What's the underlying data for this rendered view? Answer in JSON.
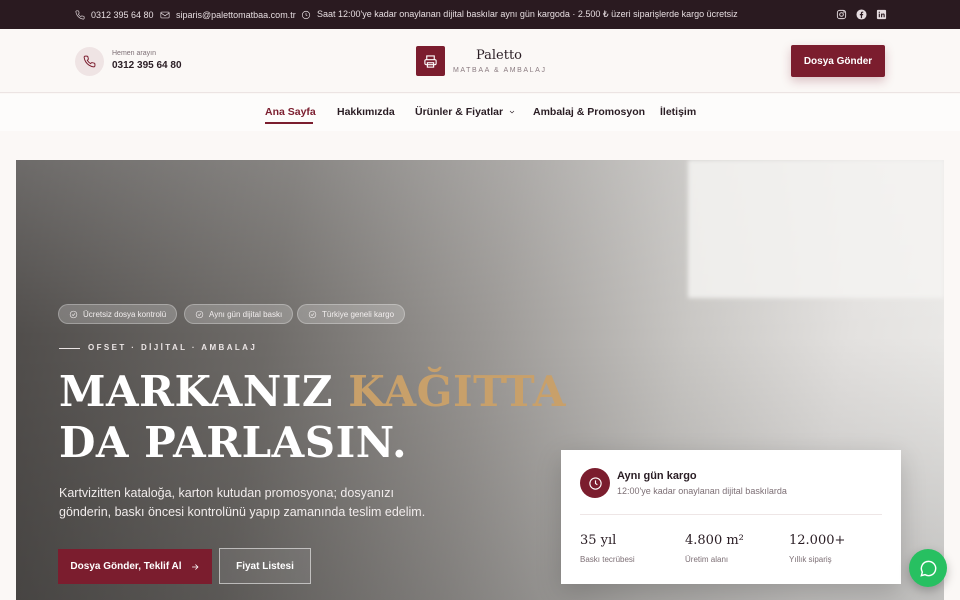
{
  "topbar": {
    "phone": "0312 395 64 80",
    "email": "siparis@palettomatbaa.com.tr",
    "notice": "Saat 12:00'ye kadar onaylanan dijital baskılar aynı gün kargoda · 2.500 ₺ üzeri siparişlerde kargo ücretsiz",
    "social_icons": [
      "instagram-icon",
      "facebook-icon",
      "linkedin-icon"
    ]
  },
  "header": {
    "call_label": "Hemen arayın",
    "call_number": "0312 395 64 80",
    "brand": "Paletto",
    "tagline": "MATBAA & AMBALAJ",
    "cta": "Dosya Gönder"
  },
  "nav": {
    "items": [
      {
        "label": "Ana Sayfa",
        "active": true
      },
      {
        "label": "Hakkımızda"
      },
      {
        "label": "Ürünler & Fiyatlar",
        "dropdown": true
      },
      {
        "label": "Ambalaj & Promosyon"
      },
      {
        "label": "İletişim"
      }
    ]
  },
  "hero": {
    "pills": [
      "Ücretsiz dosya kontrolü",
      "Aynı gün dijital baskı",
      "Türkiye geneli kargo"
    ],
    "eyebrow": "OFSET · DİJİTAL · AMBALAJ",
    "headline_line1_a": "MARKANIZ ",
    "headline_line1_accent": "KAĞITTA",
    "headline_line2": "DA PARLASIN.",
    "description": "Kartvizitten kataloğa, karton kutudan promosyona; dosyanızı gönderin, baskı öncesi kontrolünü yapıp zamanında teslim edelim.",
    "primary_button": "Dosya Gönder, Teklif Al",
    "secondary_button": "Fiyat Listesi"
  },
  "card": {
    "title": "Aynı gün kargo",
    "subtitle": "12:00'ye kadar onaylanan dijital baskılarda",
    "stats": [
      {
        "value": "35 yıl",
        "label": "Baskı tecrübesi"
      },
      {
        "value": "4.800 m²",
        "label": "Üretim alanı"
      },
      {
        "value": "12.000+",
        "label": "Yıllık sipariş"
      }
    ]
  },
  "colors": {
    "brand": "#7b1d2e",
    "accent": "#c8a06a",
    "topbar": "#2a1a20",
    "chat": "#27c061"
  }
}
